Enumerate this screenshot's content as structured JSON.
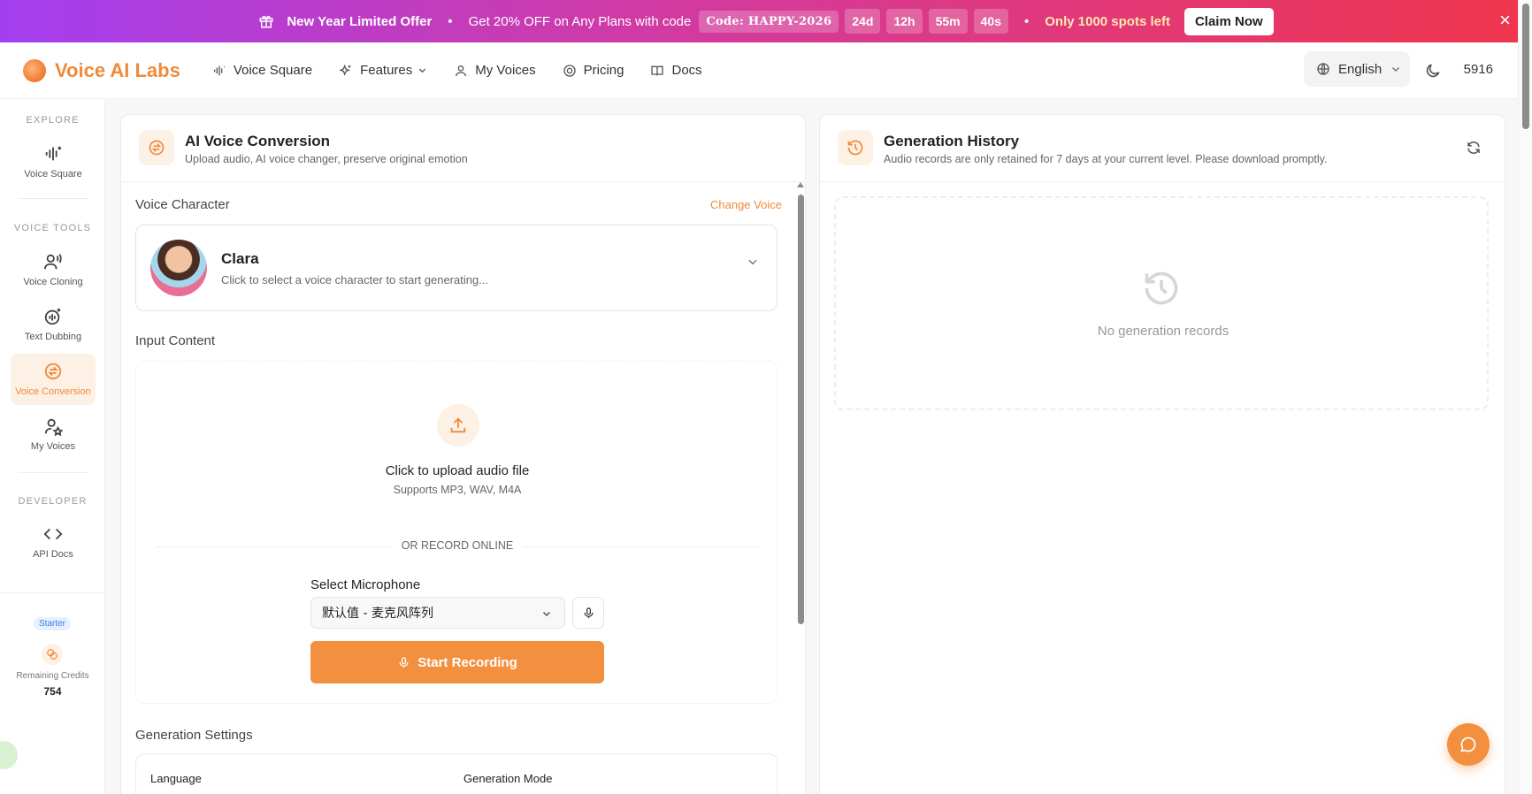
{
  "promo": {
    "title": "New Year Limited Offer",
    "subtitle": "Get 20% OFF on Any Plans with code",
    "code": "Code: HAPPY-2026",
    "countdown": [
      "24d",
      "12h",
      "55m",
      "40s"
    ],
    "spots": "Only 1000 spots left",
    "claim": "Claim Now",
    "close": "×"
  },
  "brand": {
    "name": "Voice AI Labs"
  },
  "nav": {
    "voice_square": "Voice Square",
    "features": "Features",
    "my_voices": "My Voices",
    "pricing": "Pricing",
    "docs": "Docs",
    "language": "English",
    "user": "5916"
  },
  "sidebar": {
    "explore": "EXPLORE",
    "voice_square": "Voice Square",
    "voice_tools": "VOICE TOOLS",
    "voice_cloning": "Voice Cloning",
    "text_dubbing": "Text Dubbing",
    "voice_conversion": "Voice Conversion",
    "my_voices": "My Voices",
    "developer": "DEVELOPER",
    "api_docs": "API Docs",
    "plan": "Starter",
    "credits_label": "Remaining Credits",
    "credits": "754"
  },
  "conversion": {
    "title": "AI Voice Conversion",
    "subtitle": "Upload audio, AI voice changer, preserve original emotion",
    "voice_character": "Voice Character",
    "change_voice": "Change Voice",
    "voice_name": "Clara",
    "voice_hint": "Click to select a voice character to start generating...",
    "input_content": "Input Content",
    "upload_title": "Click to upload audio file",
    "upload_sub": "Supports MP3, WAV, M4A",
    "or_record": "OR RECORD ONLINE",
    "select_mic": "Select Microphone",
    "mic_value": "默认值 - 麦克风阵列",
    "start_recording": "Start Recording",
    "generation_settings": "Generation Settings",
    "language_label": "Language",
    "mode_label": "Generation Mode"
  },
  "history": {
    "title": "Generation History",
    "subtitle": "Audio records are only retained for 7 days at your current level. Please download promptly.",
    "empty": "No generation records"
  },
  "colors": {
    "accent": "#f39040",
    "brand": "#f08a3a"
  }
}
